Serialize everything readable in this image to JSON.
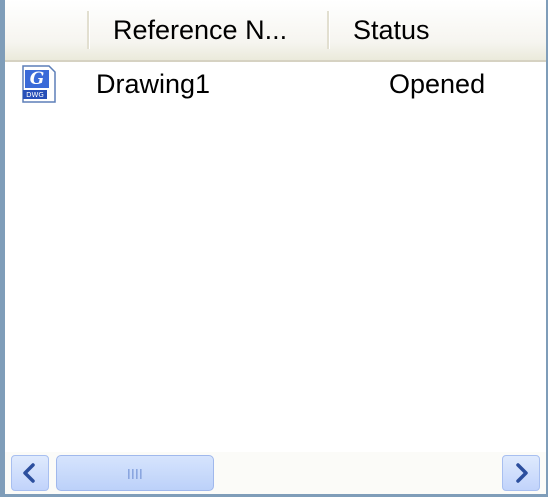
{
  "list": {
    "columns": [
      {
        "label": ""
      },
      {
        "label": "Reference N..."
      },
      {
        "label": "Status"
      }
    ],
    "rows": [
      {
        "icon": "dwg-file-icon",
        "name": "Drawing1",
        "status": "Opened"
      }
    ]
  },
  "colors": {
    "border": "#7f9db9",
    "header_bg": "#ebeadb",
    "scroll_button": "#c1d3fb"
  },
  "icons": {
    "scroll_left": "chevron-left-icon",
    "scroll_right": "chevron-right-icon",
    "thumb_grip": "grip-icon"
  }
}
